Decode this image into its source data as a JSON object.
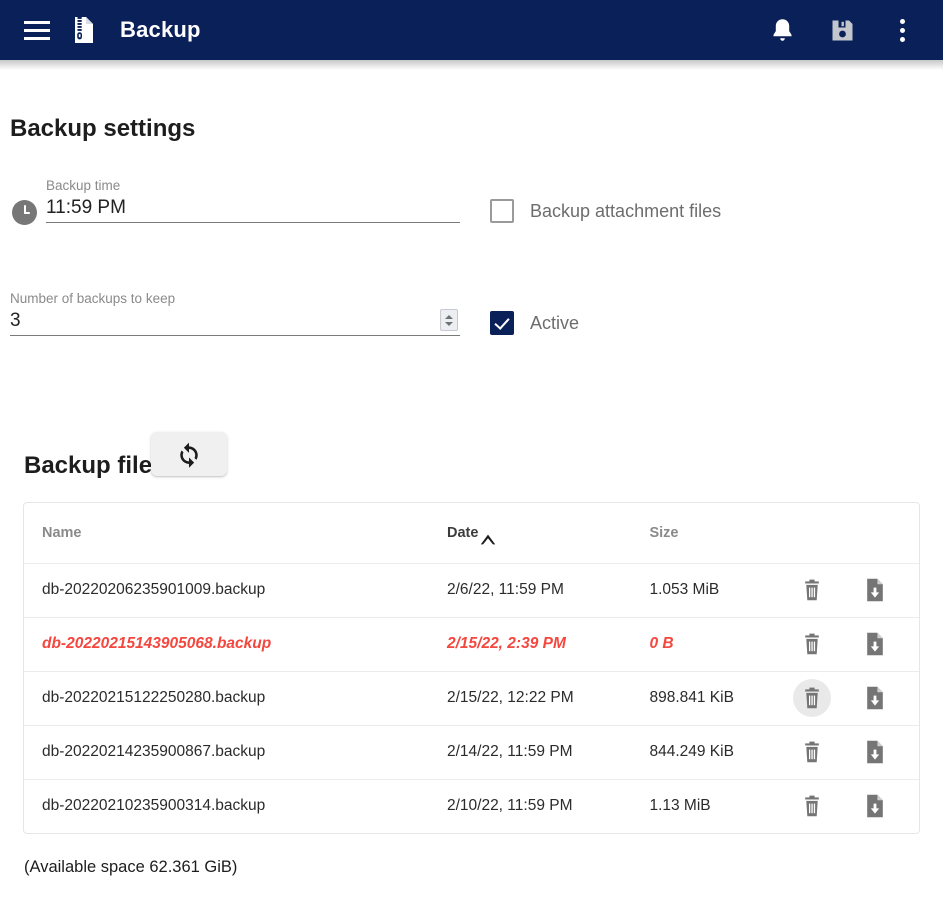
{
  "appbar": {
    "menu_icon": "hamburger-menu-icon",
    "app_icon": "archive-file-icon",
    "title": "Backup",
    "notifications_icon": "bell-icon",
    "save_icon": "floppy-disk-save-icon",
    "overflow_icon": "kebab-menu-icon",
    "background_color": "#0a2059",
    "save_icon_color": "#c3c7cd",
    "save_disabled": true
  },
  "settings": {
    "title": "Backup settings",
    "backup_time": {
      "icon": "clock-icon",
      "label": "Backup time",
      "value": "11:59 PM",
      "placeholder": "Backup time"
    },
    "backups_to_keep": {
      "label": "Number of backups to keep",
      "value": "3",
      "placeholder": "Number of backups to keep",
      "stepper_icon": "spinner-arrows-icon"
    },
    "attachment_files": {
      "label": "Backup attachment files",
      "checked": false
    },
    "active": {
      "label": "Active",
      "checked": true,
      "accent_color": "#0a2059"
    }
  },
  "files_section": {
    "title": "Backup files",
    "refresh_icon": "refresh-sync-icon",
    "refresh_label": "Refresh",
    "columns": [
      {
        "key": "name",
        "label": "Name",
        "sorted": false
      },
      {
        "key": "date",
        "label": "Date",
        "sorted": true,
        "direction": "asc",
        "sort_icon": "chevron-up-icon"
      },
      {
        "key": "size",
        "label": "Size",
        "sorted": false
      }
    ],
    "rows": [
      {
        "name": "db-20220206235901009.backup",
        "date": "2/6/22, 11:59 PM",
        "size": "1.053 MiB",
        "flagged": false,
        "delete_icon": "trash-icon",
        "download_icon": "file-download-icon",
        "delete_hovered": false
      },
      {
        "name": "db-20220215143905068.backup",
        "date": "2/15/22, 2:39 PM",
        "size": "0 B",
        "flagged": true,
        "delete_icon": "trash-icon",
        "download_icon": "file-download-icon",
        "delete_hovered": false
      },
      {
        "name": "db-20220215122250280.backup",
        "date": "2/15/22, 12:22 PM",
        "size": "898.841 KiB",
        "flagged": false,
        "delete_icon": "trash-icon",
        "download_icon": "file-download-icon",
        "delete_hovered": true
      },
      {
        "name": "db-20220214235900867.backup",
        "date": "2/14/22, 11:59 PM",
        "size": "844.249 KiB",
        "flagged": false,
        "delete_icon": "trash-icon",
        "download_icon": "file-download-icon",
        "delete_hovered": false
      },
      {
        "name": "db-20220210235900314.backup",
        "date": "2/10/22, 11:59 PM",
        "size": "1.13 MiB",
        "flagged": false,
        "delete_icon": "trash-icon",
        "download_icon": "file-download-icon",
        "delete_hovered": false
      }
    ],
    "flag_color": "#f4473f",
    "available_space": "(Available space 62.361 GiB)"
  }
}
